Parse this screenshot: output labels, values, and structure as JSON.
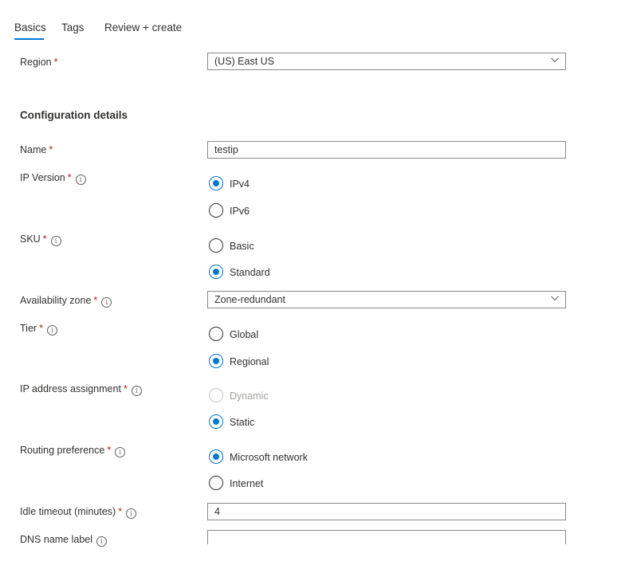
{
  "tabs": [
    {
      "label": "Basics",
      "active": true
    },
    {
      "label": "Tags",
      "active": false
    },
    {
      "label": "Review + create",
      "active": false
    }
  ],
  "region": {
    "label": "Region",
    "required": "*",
    "value": "(US) East US"
  },
  "section": {
    "heading": "Configuration details"
  },
  "name": {
    "label": "Name",
    "required": "*",
    "value": "testip"
  },
  "ip_version": {
    "label": "IP Version",
    "required": "*",
    "info": "i",
    "options": [
      {
        "label": "IPv4",
        "checked": true
      },
      {
        "label": "IPv6",
        "checked": false
      }
    ]
  },
  "sku": {
    "label": "SKU",
    "required": "*",
    "info": "i",
    "options": [
      {
        "label": "Basic",
        "checked": false
      },
      {
        "label": "Standard",
        "checked": true
      }
    ]
  },
  "availability_zone": {
    "label": "Availability zone",
    "required": "*",
    "info": "i",
    "value": "Zone-redundant"
  },
  "tier": {
    "label": "Tier",
    "required": "*",
    "info": "i",
    "options": [
      {
        "label": "Global",
        "checked": false
      },
      {
        "label": "Regional",
        "checked": true
      }
    ]
  },
  "ip_assignment": {
    "label": "IP address assignment",
    "required": "*",
    "info": "i",
    "options": [
      {
        "label": "Dynamic",
        "checked": false,
        "disabled": true
      },
      {
        "label": "Static",
        "checked": true
      }
    ]
  },
  "routing": {
    "label": "Routing preference",
    "required": "*",
    "info": "i",
    "options": [
      {
        "label": "Microsoft network",
        "checked": true
      },
      {
        "label": "Internet",
        "checked": false
      }
    ]
  },
  "idle_timeout": {
    "label": "Idle timeout (minutes)",
    "required": "*",
    "info": "i",
    "value": "4"
  },
  "dns": {
    "label": "DNS name label",
    "info": "i",
    "value": ""
  },
  "colors": {
    "accent": "#0078d4",
    "required": "#a4262c",
    "text": "#323130",
    "border": "#8a8886"
  },
  "icons": {
    "chevron": "chevron-down-icon",
    "info": "info-icon"
  }
}
